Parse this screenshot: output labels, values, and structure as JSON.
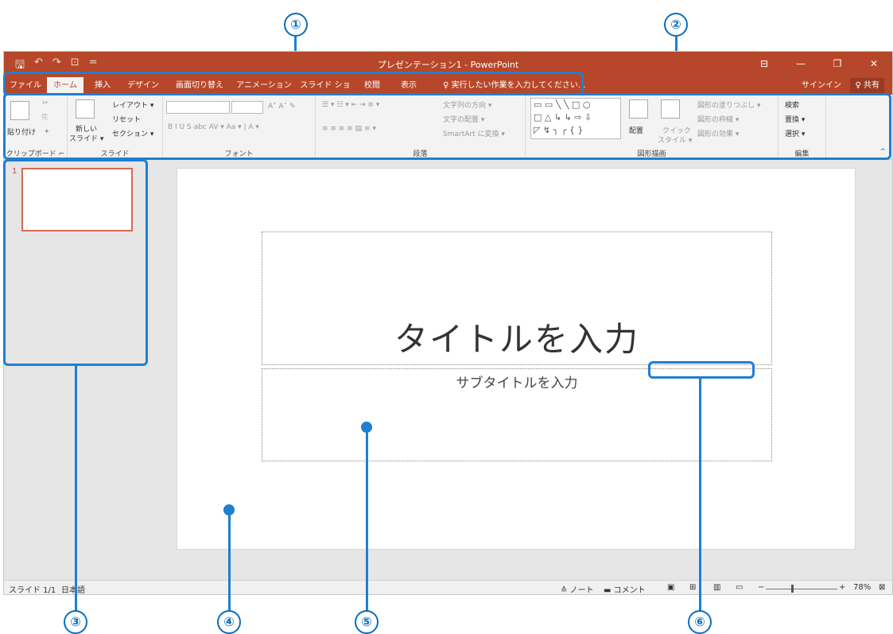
{
  "window": {
    "title": "プレゼンテーション1 - PowerPoint",
    "qat": [
      "🖫",
      "↶",
      "↷",
      "⊡",
      "="
    ],
    "controls": [
      "⊟",
      "—",
      "❐",
      "✕"
    ]
  },
  "tabs": [
    "ファイル",
    "ホーム",
    "挿入",
    "デザイン",
    "画面切り替え",
    "アニメーション",
    "スライド ショー",
    "校閲",
    "表示"
  ],
  "tell_me": "♀ 実行したい作業を入力してください...",
  "signin": "サインイン",
  "share": "♀ 共有",
  "ribbon": {
    "clipboard": {
      "paste": "貼り付け",
      "label": "クリップボード ⌐"
    },
    "slides": {
      "new": "新しい",
      "new2": "スライド ▾",
      "layout": "レイアウト ▾",
      "reset": "リセット",
      "section": "セクション ▾",
      "label": "スライド"
    },
    "font": {
      "buttons": "B  I  U  S  abc  AV ▾  Aa ▾  |  A ▾",
      "label": "フォント"
    },
    "paragraph": {
      "direction": "文字列の方向 ▾",
      "align": "文字の配置 ▾",
      "smartart": "SmartArt に変換 ▾",
      "label": "段落"
    },
    "drawing": {
      "arrange": "配置",
      "quick_style": "クイック",
      "quick_style2": "スタイル ▾",
      "fill": "図形の塗りつぶし ▾",
      "outline": "図形の枠線 ▾",
      "effect": "図形の効果 ▾",
      "label": "図形描画"
    },
    "editing": {
      "find": "検索",
      "replace": "置換 ▾",
      "select": "選択 ▾",
      "label": "編集"
    },
    "collapse": "^"
  },
  "thumbnail": {
    "number": "1"
  },
  "slide": {
    "title": "タイトルを入力",
    "subtitle": "サブタイトルを入力"
  },
  "status": {
    "slide": "スライド 1/1",
    "lang": "日本語",
    "notes": "≙ ノート",
    "comments": "▬ コメント",
    "zoom_minus": "−",
    "zoom_plus": "+",
    "zoom": "78%",
    "fit": "⊠"
  },
  "callouts": [
    "①",
    "②",
    "③",
    "④",
    "⑤",
    "⑥"
  ]
}
